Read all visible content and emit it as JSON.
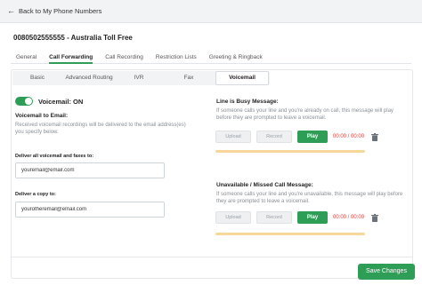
{
  "topbar": {
    "back_label": "Back to My Phone Numbers"
  },
  "header": {
    "title": "0080502555555 - Australia Toll Free"
  },
  "tabs": [
    {
      "label": "General"
    },
    {
      "label": "Call Forwarding"
    },
    {
      "label": "Call Recording"
    },
    {
      "label": "Restriction Lists"
    },
    {
      "label": "Greeting & Ringback"
    }
  ],
  "active_tab": "Call Forwarding",
  "subtabs": [
    {
      "label": "Basic"
    },
    {
      "label": "Advanced Routing"
    },
    {
      "label": "IVR"
    },
    {
      "label": "Fax"
    },
    {
      "label": "Voicemail"
    }
  ],
  "active_subtab": "Voicemail",
  "voicemail": {
    "status_label": "Voicemail: ON",
    "enabled": true,
    "email_heading": "Voicemail to Email:",
    "email_helper": "Received voicemail recordings will be delivered to the email address(es) you specify below.",
    "deliver_label": "Deliver all voicemail and faxes to:",
    "deliver_value": "youremail@email.com",
    "copy_label": "Deliver a copy to:",
    "copy_value": "yourotheremail@email.com"
  },
  "busy": {
    "title": "Line is Busy Message:",
    "description": "If someone calls your line and you're already on call, this message will play before they are prompted to leave a voicemail.",
    "upload_label": "Upload",
    "record_label": "Record",
    "play_label": "Play",
    "time": "00:00 / 00:00"
  },
  "unavailable": {
    "title": "Unavailable / Missed Call Message:",
    "description": "If someone calls your line and you're unavailable, this message will play before they are prompted to leave a voicemail.",
    "upload_label": "Upload",
    "record_label": "Record",
    "play_label": "Play",
    "time": "00:00 / 00:00"
  },
  "footer": {
    "save_label": "Save Changes"
  },
  "colors": {
    "accent": "#2e9e57",
    "time_text": "#e53935",
    "progress": "#f7d89a"
  },
  "icons": {
    "back": "arrow-left-icon",
    "delete": "trash-icon"
  }
}
